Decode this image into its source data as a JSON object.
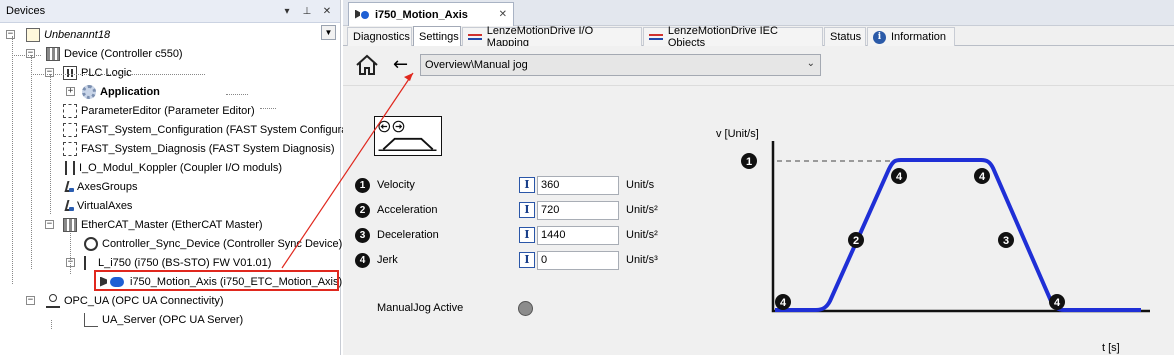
{
  "devices_panel": {
    "title": "Devices",
    "title_buttons": [
      "▾",
      "📌",
      "✕"
    ],
    "tree": [
      {
        "id": "project",
        "label": "Unbenannt18",
        "style": "italic",
        "icon": "project-icon",
        "expander": "−"
      },
      {
        "id": "device",
        "label": "Device (Controller c550)",
        "icon": "controller-icon",
        "expander": "−"
      },
      {
        "id": "plc",
        "label": "PLC Logic",
        "icon": "plc-logic-icon",
        "expander": "−"
      },
      {
        "id": "application",
        "label": "Application",
        "style": "bold",
        "icon": "application-gear-icon",
        "expander": "+"
      },
      {
        "id": "param_editor",
        "label": "ParameterEditor (Parameter Editor)",
        "icon": "dashed-box-icon"
      },
      {
        "id": "fast_cfg",
        "label": "FAST_System_Configuration (FAST System Configura",
        "icon": "dashed-box-icon"
      },
      {
        "id": "fast_diag",
        "label": "FAST_System_Diagnosis (FAST System Diagnosis)",
        "icon": "dashed-box-icon"
      },
      {
        "id": "io_koppler",
        "label": "I_O_Modul_Koppler (Coupler I/O moduls)",
        "icon": "io-module-icon"
      },
      {
        "id": "axes_groups",
        "label": "AxesGroups",
        "icon": "axis-icon"
      },
      {
        "id": "virtual_axes",
        "label": "VirtualAxes",
        "icon": "axis-icon"
      },
      {
        "id": "ethercat",
        "label": "EtherCAT_Master (EtherCAT Master)",
        "icon": "ethercat-icon",
        "expander": "−"
      },
      {
        "id": "sync_device",
        "label": "Controller_Sync_Device (Controller Sync Device)",
        "icon": "sync-device-icon"
      },
      {
        "id": "l_i750",
        "label": "L_i750 (i750 (BS-STO) FW V01.01)",
        "icon": "drive-icon",
        "expander": "−"
      },
      {
        "id": "motion_axis",
        "label": "i750_Motion_Axis (i750_ETC_Motion_Axis)",
        "icon": "motion-axis-icon",
        "selected": true
      },
      {
        "id": "opc_ua",
        "label": "OPC_UA (OPC UA Connectivity)",
        "icon": "opc-ua-icon",
        "expander": "−"
      },
      {
        "id": "ua_server",
        "label": "UA_Server (OPC UA Server)",
        "icon": "ua-server-icon"
      }
    ]
  },
  "editor": {
    "doc_tab": {
      "label": "i750_Motion_Axis",
      "close": "✕"
    },
    "sub_tabs": [
      {
        "label": "Diagnostics",
        "active": false,
        "icon": ""
      },
      {
        "label": "Settings",
        "active": true,
        "icon": ""
      },
      {
        "label": "LenzeMotionDrive I/O Mapping",
        "active": false,
        "icon": "mapping-icon"
      },
      {
        "label": "LenzeMotionDrive IEC Objects",
        "active": false,
        "icon": "mapping-icon"
      },
      {
        "label": "Status",
        "active": false,
        "icon": ""
      },
      {
        "label": "Information",
        "active": false,
        "icon": "info-icon"
      }
    ],
    "nav": {
      "back_glyph": "←",
      "path_value": "Overview\\Manual jog",
      "dropdown_glyph": "⌄"
    },
    "parameters": [
      {
        "num": "1",
        "label": "Velocity",
        "value": "360",
        "unit": "Unit/s"
      },
      {
        "num": "2",
        "label": "Acceleration",
        "value": "720",
        "unit": "Unit/s²"
      },
      {
        "num": "3",
        "label": "Deceleration",
        "value": "1440",
        "unit": "Unit/s²"
      },
      {
        "num": "4",
        "label": "Jerk",
        "value": "0",
        "unit": "Unit/s³"
      }
    ],
    "input_button_glyph": "I",
    "manual_jog": {
      "label": "ManualJog Active",
      "state": "inactive",
      "led_color": "#8c8c8c"
    },
    "graph": {
      "y_label": "v [Unit/s]",
      "x_label": "t [s]",
      "curve_color": "#1f2fd6",
      "markers": [
        "1",
        "2",
        "3",
        "4"
      ]
    }
  },
  "colors": {
    "selection_highlight": "#e0281e",
    "badge": "#111111"
  }
}
